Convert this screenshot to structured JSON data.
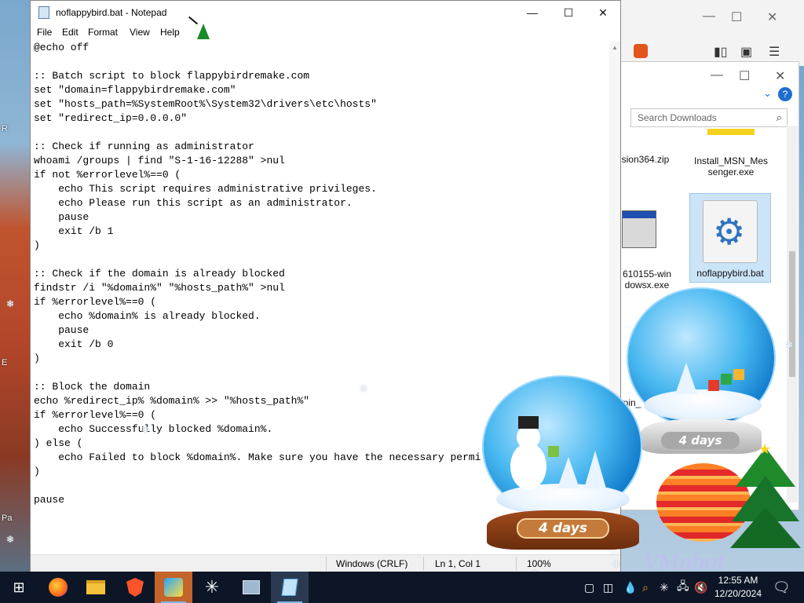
{
  "notepad": {
    "title": "noflappybird.bat - Notepad",
    "menu": [
      "File",
      "Edit",
      "Format",
      "View",
      "Help"
    ],
    "lines": [
      "@echo off",
      "",
      ":: Batch script to block flappybirdremake.com",
      "set \"domain=flappybirdremake.com\"",
      "set \"hosts_path=%SystemRoot%\\System32\\drivers\\etc\\hosts\"",
      "set \"redirect_ip=0.0.0.0\"",
      "",
      ":: Check if running as administrator",
      "whoami /groups | find \"S-1-16-12288\" >nul",
      "if not %errorlevel%==0 (",
      "    echo This script requires administrative privileges.",
      "    echo Please run this script as an administrator.",
      "    pause",
      "    exit /b 1",
      ")",
      "",
      ":: Check if the domain is already blocked",
      "findstr /i \"%domain%\" \"%hosts_path%\" >nul",
      "if %errorlevel%==0 (",
      "    echo %domain% is already blocked.",
      "    pause",
      "    exit /b 0",
      ")",
      "",
      ":: Block the domain",
      "echo %redirect_ip% %domain% >> \"%hosts_path%\"",
      "if %errorlevel%==0 (",
      "    echo Successfully blocked %domain%.",
      ") else (",
      "    echo Failed to block %domain%. Make sure you have the necessary permi",
      ")",
      "",
      "pause"
    ],
    "status": {
      "eol": "Windows (CRLF)",
      "position": "Ln 1, Col 1",
      "zoom": "100%"
    }
  },
  "downloads": {
    "search_placeholder": "Search Downloads",
    "files": [
      {
        "name": "sion364.zip"
      },
      {
        "name": "Install_MSN_Messenger.exe"
      },
      {
        "name": "610155-windowsx.exe"
      },
      {
        "name": "noflappybird.bat"
      },
      {
        "name": "pin_"
      }
    ]
  },
  "globes": {
    "label_left": "4 days",
    "label_right": "4 days"
  },
  "watermark": "VMobot",
  "clock": {
    "time": "12:55 AM",
    "date": "12/20/2024"
  },
  "desktop_labels": [
    "R",
    "E",
    "Pa"
  ],
  "colors": {
    "accent": "#0078d7",
    "taskbar": "#0c1626"
  }
}
